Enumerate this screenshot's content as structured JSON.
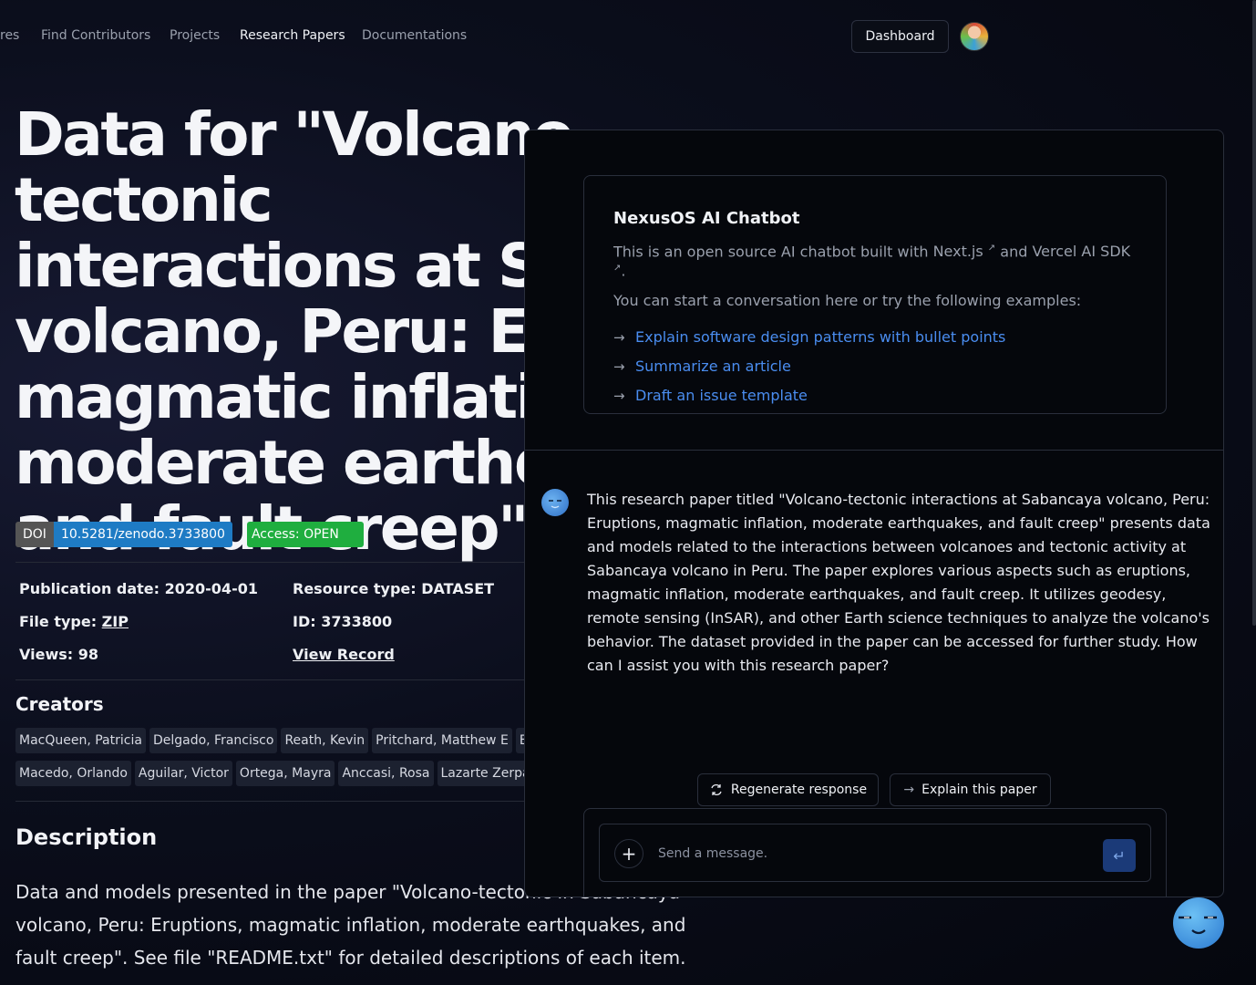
{
  "nav": {
    "items": [
      {
        "label": "res"
      },
      {
        "label": "Find Contributors"
      },
      {
        "label": "Projects"
      },
      {
        "label": "Research Papers",
        "active": true
      },
      {
        "label": "Documentations"
      }
    ],
    "dashboard_label": "Dashboard"
  },
  "paper": {
    "title": "Data for \"Volcano-tectonic interactions at Sabancaya volcano, Peru: Eruptions, magmatic inflation, moderate earthquakes, and fault creep\"",
    "title_visible_lines": [
      "Data for \"Volcano-tectonic",
      "interactions at Sal",
      "volcano, Peru: Eru",
      "magmatic inflatio",
      "moderate earthqu",
      "and fault creep\""
    ],
    "doi_label": "DOI",
    "doi_value": "10.5281/zenodo.3733800",
    "access": "Access: OPEN",
    "publication_date_label": "Publication date: 2020-04-01",
    "resource_type_label": "Resource type: DATASET",
    "file_type_prefix": "File type: ",
    "file_type_value": "ZIP",
    "id_label": "ID: 3733800",
    "views_label": "Views: 98",
    "view_record": "View Record",
    "creators_heading": "Creators",
    "creators_row1": [
      "MacQueen, Patricia",
      "Delgado, Francisco",
      "Reath, Kevin",
      "Pritchard, Matthew E",
      "Bagna"
    ],
    "creators_row2": [
      "Macedo, Orlando",
      "Aguilar, Victor",
      "Ortega, Mayra",
      "Anccasi, Rosa",
      "Lazarte Zerpa, Ivon"
    ],
    "description_heading": "Description",
    "description": "Data and models presented in the paper \"Volcano-tectonic in Sabancaya volcano, Peru: Eruptions, magmatic inflation, moderate earthquakes, and fault creep\".  See file \"README.txt\" for detailed descriptions of each item."
  },
  "chat": {
    "welcome_title": "NexusOS AI Chatbot",
    "welcome_intro_1": "This is an open source AI chatbot built with ",
    "nextjs_link": "Next.js",
    "welcome_intro_and": " and ",
    "vercel_link": "Vercel AI SDK",
    "welcome_intro_end": ".",
    "external_mark": "↗",
    "welcome_examples_intro": "You can start a conversation here or try the following examples:",
    "examples": [
      "Explain software design patterns with bullet points",
      "Summarize an article",
      "Draft an issue template"
    ],
    "bot_message": "This research paper titled \"Volcano-tectonic interactions at Sabancaya volcano, Peru: Eruptions, magmatic inflation, moderate earthquakes, and fault creep\" presents data and models related to the interactions between volcanoes and tectonic activity at Sabancaya volcano in Peru. The paper explores various aspects such as eruptions, magmatic inflation, moderate earthquakes, and fault creep. It utilizes geodesy, remote sensing (InSAR), and other Earth science techniques to analyze the volcano's behavior. The dataset provided in the paper can be accessed for further study. How can I assist you with this research paper?",
    "regenerate_label": "Regenerate response",
    "explain_label": "Explain this paper",
    "input_placeholder": "Send a message.",
    "input_value": ""
  },
  "icons": {
    "example_arrow": "arrow-right-icon",
    "regenerate": "refresh-icon",
    "explain": "arrow-right-icon",
    "plus": "plus-icon",
    "send": "enter-icon"
  },
  "colors": {
    "link_blue": "#4a8df0",
    "doi_blue": "#1e7bc4",
    "access_green": "#1fae3f",
    "send_button": "#1b3a78"
  }
}
